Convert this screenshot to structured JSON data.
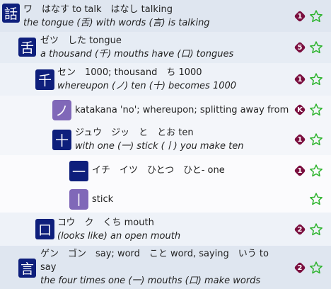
{
  "theme": {
    "badge_color": "#7b0f3f",
    "star_color": "#2bb32b",
    "kanji_bg": "#0e1f7c",
    "component_bg": "#8068b8"
  },
  "rows": [
    {
      "kanji": "話",
      "kanji_style": "navy",
      "line1": "ワ　はなす to talk　はなし talking",
      "line2": "the tongue (舌) with words (言) is talking",
      "badge": "1",
      "star": "star-outline-icon"
    },
    {
      "kanji": "舌",
      "kanji_style": "navy",
      "line1": "ゼツ　した tongue",
      "line2": "a thousand (千) mouths have (口) tongues",
      "badge": "5",
      "star": "star-outline-icon"
    },
    {
      "kanji": "千",
      "kanji_style": "navy",
      "line1": "セン　1000; thousand　ち 1000",
      "line2": "whereupon (ノ) ten (十) becomes 1000",
      "badge": "1",
      "star": "star-outline-icon"
    },
    {
      "kanji": "ノ",
      "kanji_style": "purple",
      "line1": "katakana 'no'; whereupon; splitting away from",
      "line2": "",
      "badge": "K",
      "star": "star-outline-icon"
    },
    {
      "kanji": "十",
      "kanji_style": "navy",
      "line1": "ジュウ　ジッ　と　とお ten",
      "line2": "with one (一) stick (丨) you make ten",
      "badge": "1",
      "star": "star-outline-icon"
    },
    {
      "kanji": "一",
      "kanji_style": "navy",
      "line1": "イチ　イツ　ひとつ　ひと- one",
      "line2": "",
      "badge": "1",
      "star": "star-outline-icon"
    },
    {
      "kanji": "丨",
      "kanji_style": "purple",
      "line1": "stick",
      "line2": "",
      "badge": "",
      "star": "star-outline-icon"
    },
    {
      "kanji": "口",
      "kanji_style": "navy",
      "line1": "コウ　ク　くち mouth",
      "line2": "(looks like) an open mouth",
      "badge": "2",
      "star": "star-outline-icon"
    },
    {
      "kanji": "言",
      "kanji_style": "navy",
      "line1": "ゲン　ゴン　say; word　こと word, saying　いう to",
      "line1b": "say",
      "line2": "the four times one (一) mouths (口) make words",
      "badge": "2",
      "star": "star-outline-icon"
    }
  ]
}
